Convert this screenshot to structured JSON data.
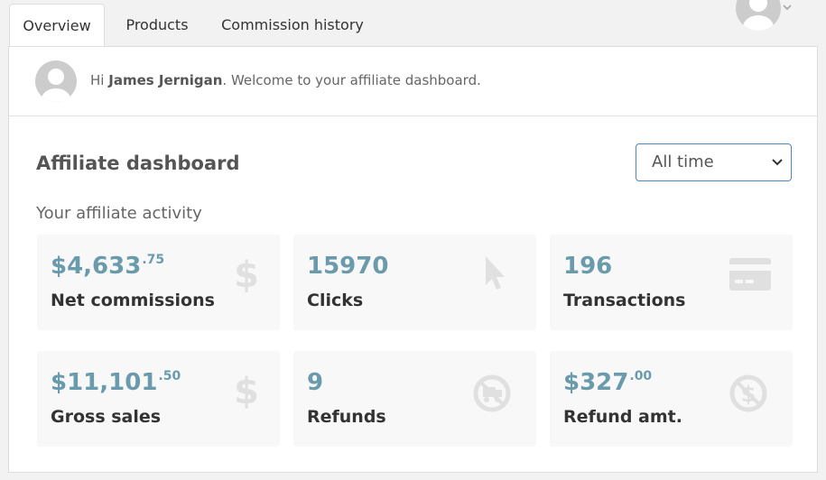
{
  "tabs": [
    {
      "label": "Overview",
      "active": true
    },
    {
      "label": "Products",
      "active": false
    },
    {
      "label": "Commission history",
      "active": false
    }
  ],
  "user_menu": {
    "icon": "avatar-icon",
    "chevron": "⌄"
  },
  "welcome": {
    "greeting": "Hi",
    "name": "James Jernigan",
    "message": ". Welcome to your affiliate dashboard."
  },
  "dashboard": {
    "title": "Affiliate dashboard",
    "period": {
      "selected": "All time",
      "options": [
        "All time"
      ]
    },
    "activity_label": "Your affiliate activity"
  },
  "stats": {
    "net_commissions": {
      "value": "$4,633",
      "cents": ".75",
      "label": "Net commissions",
      "icon": "dollar-icon"
    },
    "clicks": {
      "value": "15970",
      "label": "Clicks",
      "icon": "cursor-icon"
    },
    "transactions": {
      "value": "196",
      "label": "Transactions",
      "icon": "credit-card-icon"
    },
    "gross_sales": {
      "value": "$11,101",
      "cents": ".50",
      "label": "Gross sales",
      "icon": "dollar-icon"
    },
    "refunds": {
      "value": "9",
      "label": "Refunds",
      "icon": "no-truck-icon"
    },
    "refund_amount": {
      "value": "$327",
      "cents": ".00",
      "label": "Refund amt.",
      "icon": "no-dollar-icon"
    }
  },
  "colors": {
    "value": "#6a9bad",
    "accent_border": "#4a86c8",
    "icon": "#e0e0e0"
  }
}
